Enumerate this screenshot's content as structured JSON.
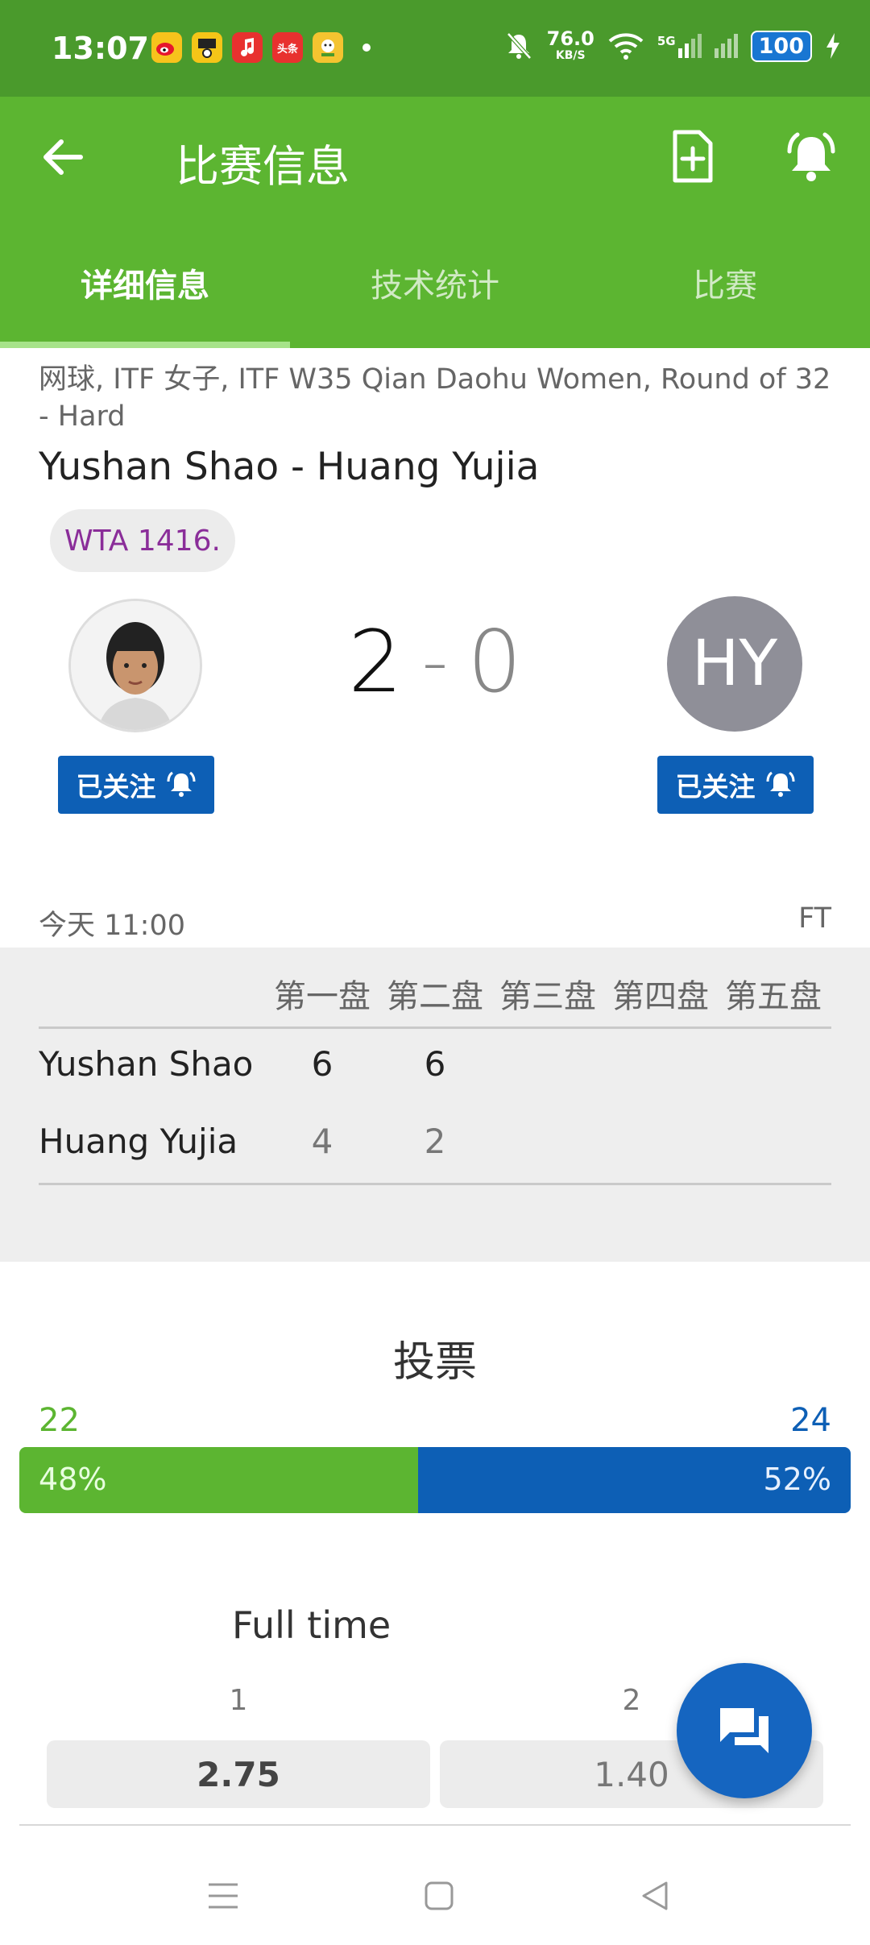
{
  "status_bar": {
    "time": "13:07",
    "apps": [
      {
        "icon": "weibo-icon",
        "bg": "#f7c31c"
      },
      {
        "icon": "news-app-icon",
        "bg": "#f5c518"
      },
      {
        "icon": "music-icon",
        "bg": "#e8312f"
      },
      {
        "icon": "toutiao-icon",
        "bg": "#e8312f",
        "label": "头条"
      },
      {
        "icon": "reading-app-icon",
        "bg": "#f4c430"
      }
    ],
    "net_speed": "76.0",
    "net_speed_unit": "KB/S",
    "network": "5G",
    "battery": "100"
  },
  "app_bar": {
    "title": "比赛信息",
    "back_icon": "back-arrow-icon",
    "add_icon": "add-document-icon",
    "bell_icon": "bell-icon"
  },
  "tabs": [
    {
      "label": "详细信息",
      "active": true
    },
    {
      "label": "技术统计",
      "active": false
    },
    {
      "label": "比赛",
      "active": false
    }
  ],
  "match": {
    "breadcrumb": "网球, ITF 女子, ITF W35 Qian Daohu Women, Round of 32 - Hard",
    "title": "Yushan Shao - Huang Yujia",
    "rank": "WTA 1416.",
    "home_score": "2",
    "score_sep": "-",
    "away_score": "0",
    "away_initials": "HY",
    "follow_label": "已关注",
    "date": "今天 11:00",
    "status": "FT"
  },
  "sets": {
    "headers": [
      "第一盘",
      "第二盘",
      "第三盘",
      "第四盘",
      "第五盘"
    ],
    "players": [
      {
        "name": "Yushan Shao",
        "scores": [
          "6",
          "6"
        ]
      },
      {
        "name": "Huang Yujia",
        "scores": [
          "4",
          "2"
        ]
      }
    ]
  },
  "vote": {
    "title": "投票",
    "left_count": "22",
    "right_count": "24",
    "left_pct": "48%",
    "right_pct": "52%",
    "left_fraction": 0.48,
    "left_color": "#5cb531",
    "right_color": "#0d5fb5"
  },
  "odds": {
    "title": "Full time",
    "labels": [
      "1",
      "2"
    ],
    "values": [
      "2.75",
      "1.40"
    ]
  },
  "fab": {
    "icon": "chat-icon"
  },
  "nav": {
    "menu_icon": "menu-icon",
    "home_icon": "home-icon",
    "back_icon": "nav-back-icon"
  }
}
